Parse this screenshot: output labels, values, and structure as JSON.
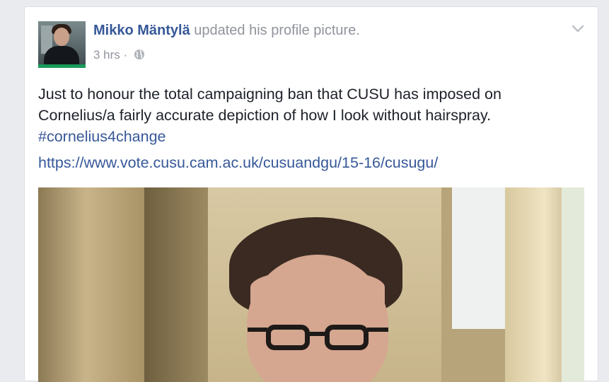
{
  "post": {
    "author": "Mikko Mäntylä",
    "action": " updated his profile picture.",
    "time": "3 hrs",
    "separator": " · ",
    "privacy_icon": "globe-icon",
    "menu_icon": "chevron-down-icon",
    "text_main": "Just to honour the total campaigning ban that CUSU has imposed on Cornelius/a fairly accurate depiction of how I look without hairspray.",
    "hashtag": "#cornelius4change",
    "link": "https://www.vote.cusu.cam.ac.uk/cusuandgu/15-16/cusugu/"
  },
  "colors": {
    "link": "#365899",
    "text": "#1d2129",
    "meta": "#90949c",
    "background": "#e9ebee"
  }
}
